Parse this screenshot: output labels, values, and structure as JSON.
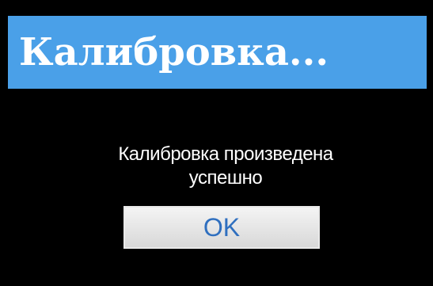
{
  "dialog": {
    "title": "Калибровка...",
    "message_line1": "Калибровка произведена",
    "message_line2": "успешно",
    "ok_label": "OK"
  },
  "colors": {
    "title_bar": "#4aa0e8",
    "background": "#000000",
    "text": "#ffffff",
    "button_text": "#2f6fbf"
  }
}
